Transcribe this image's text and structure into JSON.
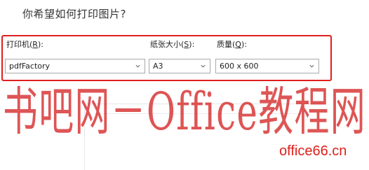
{
  "dialog": {
    "title": "你希望如何打印图片?"
  },
  "printer": {
    "label_text": "打印机(",
    "label_key": "R",
    "label_end": "):",
    "value": "pdfFactory"
  },
  "paper": {
    "label_text": "纸张大小(",
    "label_key": "S",
    "label_end": "):",
    "value": "A3"
  },
  "quality": {
    "label_text": "质量(",
    "label_key": "Q",
    "label_end": "):",
    "value": "600 x 600"
  },
  "watermark": {
    "text": "书吧网－Office教程网",
    "site": "office66.cn"
  },
  "colors": {
    "highlight": "#e01f1f",
    "watermark": "#d11414",
    "select_border": "#a9a9a9"
  },
  "icons": [
    "chevron-down-icon"
  ]
}
